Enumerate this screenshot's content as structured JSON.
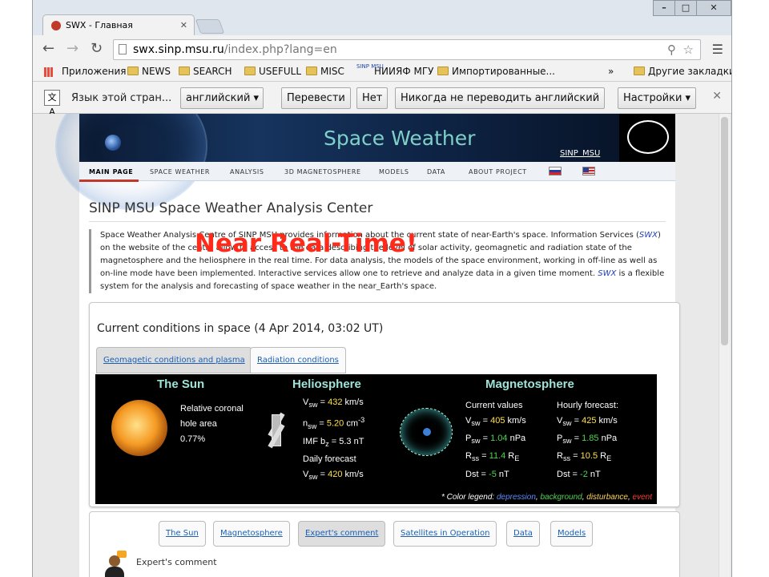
{
  "tab": {
    "title": "SWX - Главная"
  },
  "address": {
    "host": "swx.sinp.msu.ru",
    "path": "/index.php?lang=en"
  },
  "bookmarks": {
    "apps": "Приложения",
    "items": [
      "NEWS",
      "SEARCH",
      "USEFULL",
      "MISC",
      "НИИЯФ МГУ",
      "Импортированные..."
    ],
    "sinp_icon": "SINP MSU",
    "more": "»",
    "other": "Другие закладки"
  },
  "translate": {
    "label": "Язык этой стран...",
    "lang": "английский",
    "translate_btn": "Перевести",
    "no_btn": "Нет",
    "never_btn": "Никогда не переводить английский",
    "settings_btn": "Настройки"
  },
  "site": {
    "banner_title": "Space Weather",
    "banner_links": "SINP MSU",
    "nav": [
      "MAIN PAGE",
      "SPACE WEATHER",
      "ANALYSIS",
      "3D MAGNETOSPHERE",
      "MODELS",
      "DATA",
      "ABOUT PROJECT"
    ],
    "heading": "SINP MSU Space Weather Analysis Center",
    "intro": {
      "p1": "Space Weather Analysis Centre of SINP MSU provides information about the current state of near-Earth's space. Information Services (",
      "swx1": "SWX",
      "p2": ") on the website of the centre allow to access to the data describing the level of solar activity, geomagnetic and radiation state of the magnetosphere and the heliosphere in the real time. For data analysis, the models of the space environment, working in off-line as well as on-line mode have been implemented. Interactive services allow one to retrieve and analyze data in a given time moment. ",
      "swx2": "SWX",
      "p3": " is a flexible system for the analysis and forecasting of space weather in the near_Earth's space."
    },
    "overlay": "Near Real-Time!",
    "conditions_title": "Current conditions in space (4 Apr 2014, 03:02 UT)",
    "cond_tabs": [
      "Geomagetic conditions and plasma",
      "Radiation conditions"
    ],
    "panel": {
      "sun_h": "The Sun",
      "helio_h": "Heliosphere",
      "magneto_h": "Magnetosphere",
      "sun_text1": "Relative coronal",
      "sun_text2": "hole area",
      "sun_val": "0.77%",
      "vsw": "432",
      "nsw": "5.20",
      "imf": "5.3",
      "vsw_fc": "420",
      "cur_label": "Current values",
      "fc_label": "Hourly forecast:",
      "cur": {
        "v": "405",
        "p": "1.04",
        "r": "11.4",
        "dst": "-5"
      },
      "fc": {
        "v": "425",
        "p": "1.85",
        "r": "10.5",
        "dst": "-2"
      },
      "legend": {
        "prefix": "* Color legend: ",
        "d": "depression",
        "b": "background",
        "x": "disturbance",
        "e": "event"
      }
    },
    "bottom_tabs": [
      "The Sun",
      "Magnetosphere",
      "Expert's comment",
      "Satellites in Operation",
      "Data",
      "Models"
    ],
    "expert_label": "Expert's comment"
  }
}
